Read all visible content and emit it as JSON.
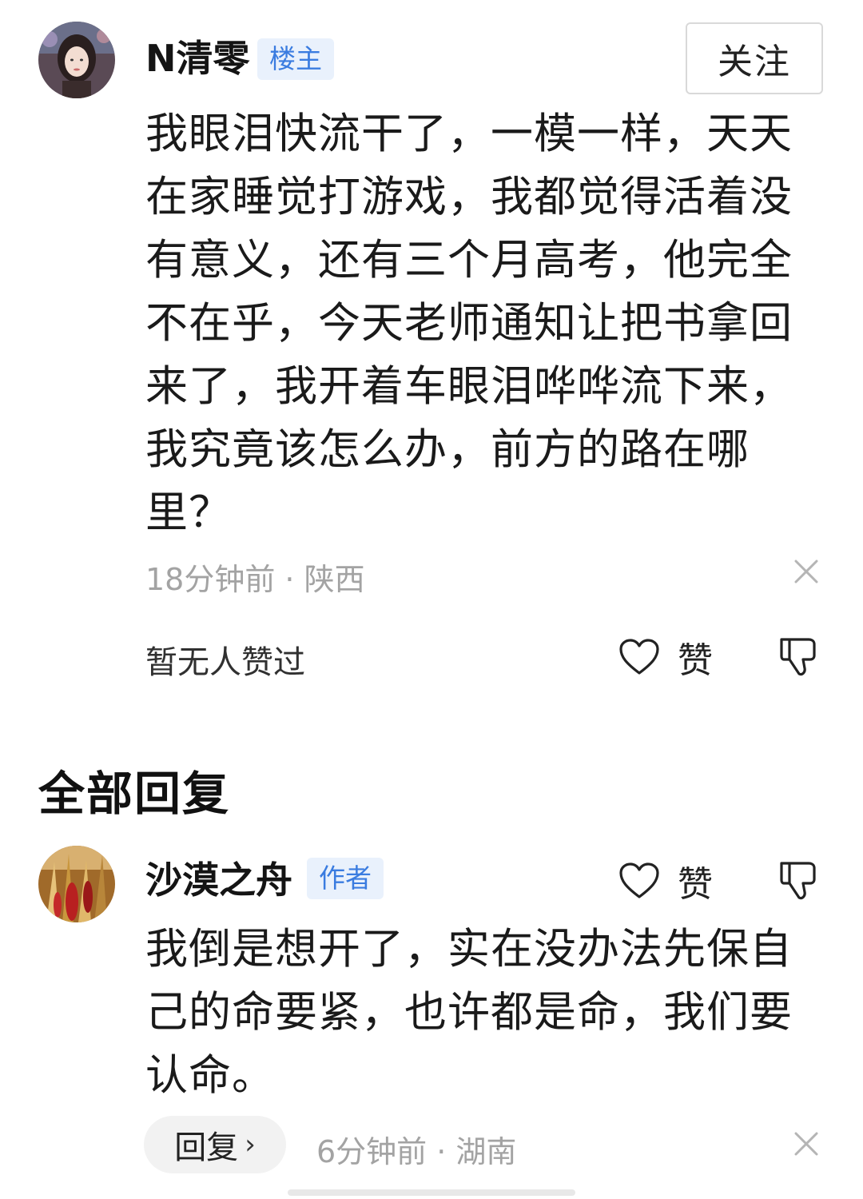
{
  "main_comment": {
    "username": "N清零",
    "tag": "楼主",
    "follow_label": "关注",
    "lines": [
      "我眼泪快流干了，一模一样，天天",
      "在家睡觉打游戏，我都觉得活着没",
      "有意义，还有三个月高考，他完全",
      "不在乎，今天老师通知让把书拿回",
      "来了，我开着车眼泪哗哗流下来，",
      "我究竟该怎么办，前方的路在哪",
      "里？"
    ],
    "meta": "18分钟前 · 陕西",
    "likes_status": "暂无人赞过",
    "like_label": "赞"
  },
  "replies_section": {
    "title": "全部回复"
  },
  "reply": {
    "username": "沙漠之舟",
    "tag": "作者",
    "like_label": "赞",
    "lines": [
      "我倒是想开了，实在没办法先保自",
      "己的命要紧，也许都是命，我们要",
      "认命。"
    ],
    "reply_button_label": "回复",
    "meta": "6分钟前 · 湖南"
  },
  "colors": {
    "tag_bg": "#e9f1fc",
    "tag_text": "#3a7ce0",
    "meta_text": "#a3a3a3"
  }
}
